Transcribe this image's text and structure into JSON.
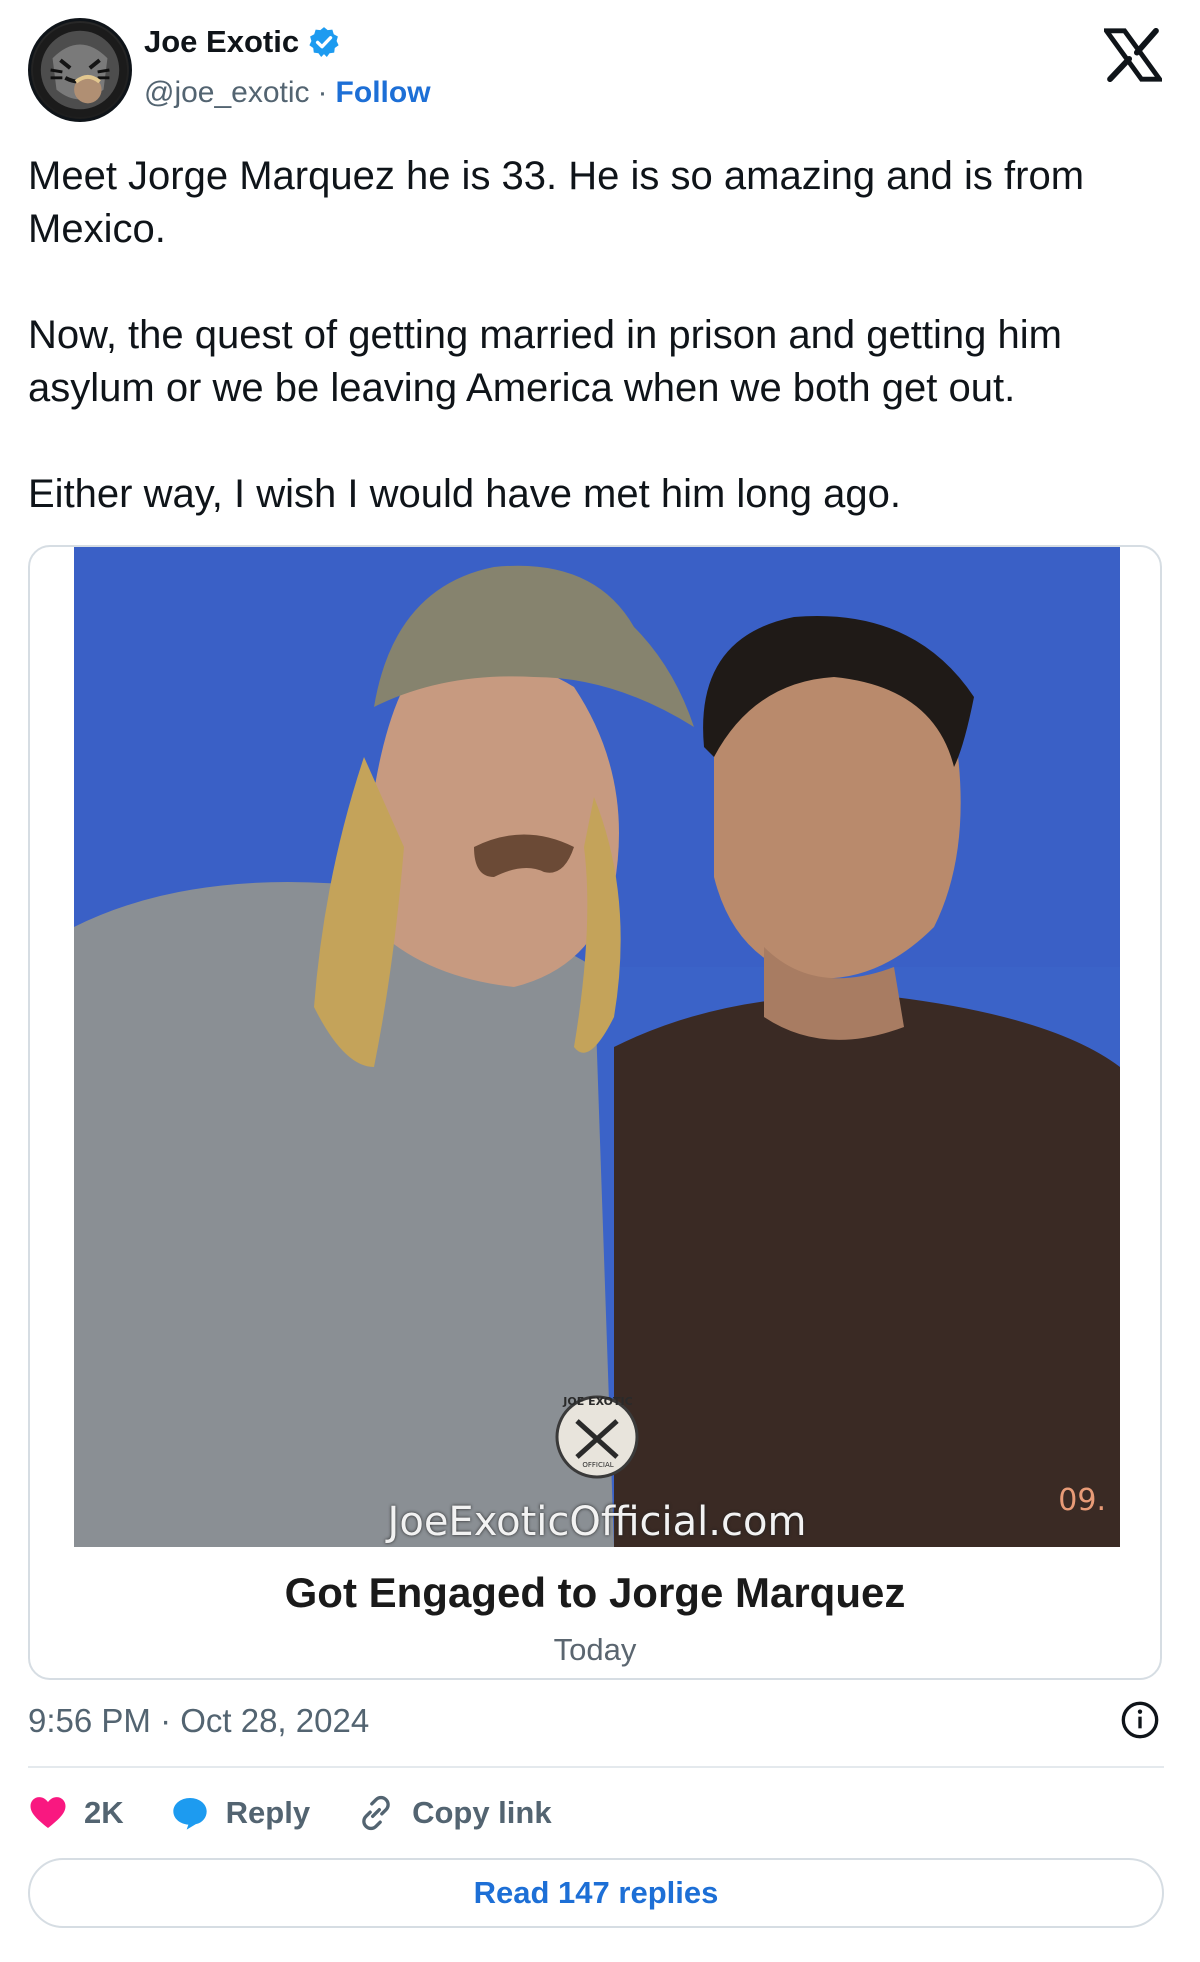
{
  "author": {
    "display_name": "Joe Exotic",
    "handle": "@joe_exotic",
    "separator": "·",
    "follow_label": "Follow",
    "verified": true
  },
  "tweet": {
    "paragraphs": [
      "Meet Jorge Marquez he is 33. He is so amazing and is from Mexico.",
      "Now, the quest of getting married in prison and getting him asylum or we be leaving America when we both get out.",
      "Either way, I wish I would have met him long ago."
    ],
    "timestamp": "9:56 PM · Oct 28, 2024"
  },
  "card": {
    "title": "Got Engaged to Jorge Marquez",
    "date": "Today",
    "photo": {
      "watermark": "JoeExoticOfficial.com",
      "seal_text": "JOE EXOTIC",
      "seal_subtext": "OFFICIAL",
      "corner_stamp": "09."
    }
  },
  "actions": {
    "likes_count": "2K",
    "reply_label": "Reply",
    "copy_link_label": "Copy link"
  },
  "read_replies_label": "Read 147 replies",
  "colors": {
    "accent": "#1d6fd6",
    "like": "#f91880",
    "verified": "#1d9bf0",
    "photo_background": "#3a62cc"
  },
  "icons": [
    "verified-badge-icon",
    "x-logo-icon",
    "info-icon",
    "heart-icon",
    "reply-bubble-icon",
    "link-icon"
  ]
}
